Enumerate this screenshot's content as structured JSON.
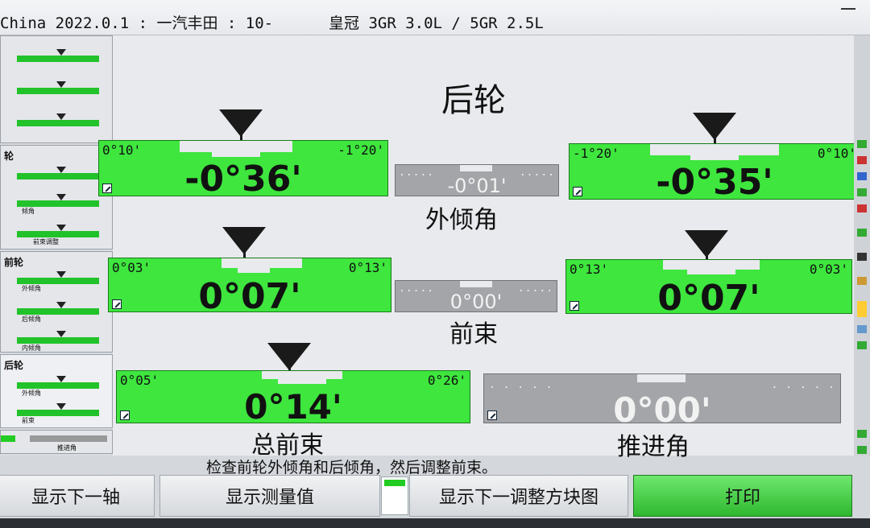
{
  "titlebar": {
    "left": "China 2022.0.1 : 一汽丰田 : 10-",
    "vehicle": "皇冠 3GR 3.0L / 5GR 2.5L"
  },
  "sidebar": {
    "groups": [
      {
        "label": ""
      },
      {
        "label": "轮",
        "items": [
          "",
          "角",
          "倾角",
          "前束调整"
        ]
      },
      {
        "label": "前轮",
        "items": [
          "外倾角",
          "后倾角",
          "内倾角"
        ]
      },
      {
        "label": "后轮",
        "items": [
          "外倾角",
          "前束"
        ]
      },
      {
        "label": "",
        "items": [
          "推进角"
        ]
      }
    ]
  },
  "main": {
    "title": "后轮",
    "camber": {
      "label": "外倾角",
      "left": {
        "range_left": "0°10'",
        "range_right": "-1°20'",
        "value": "-0°36'"
      },
      "cross": {
        "value": "-0°01'"
      },
      "right": {
        "range_left": "-1°20'",
        "range_right": "0°10'",
        "value": "-0°35'"
      }
    },
    "toe": {
      "label": "前束",
      "left": {
        "range_left": "0°03'",
        "range_right": "0°13'",
        "value": "0°07'"
      },
      "cross": {
        "value": "0°00'"
      },
      "right": {
        "range_left": "0°13'",
        "range_right": "0°03'",
        "value": "0°07'"
      }
    },
    "total_toe": {
      "label": "总前束",
      "range_left": "0°05'",
      "range_right": "0°26'",
      "value": "0°14'"
    },
    "thrust": {
      "label": "推进角",
      "value": "0°00'"
    }
  },
  "hint": "检查前轮外倾角和后倾角，然后调整前束。",
  "buttons": {
    "next_axle": "显示下一轴",
    "show_measure": "显示测量值",
    "next_adjust": "显示下一调整方块图",
    "print": "打印"
  },
  "colors": {
    "in_spec": "#3ee63e",
    "neutral": "#a3a5a8"
  }
}
